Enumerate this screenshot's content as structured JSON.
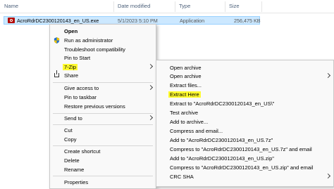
{
  "columns": {
    "name": "Name",
    "date_modified": "Date modified",
    "type": "Type",
    "size": "Size"
  },
  "file": {
    "name": "AcroRdrDC2300120143_en_US.exe",
    "date": "5/1/2023 5:10 PM",
    "type": "Application",
    "size": "256,475 KB",
    "icon": "pdf-icon"
  },
  "context_menu": {
    "open": "Open",
    "run_as_admin": "Run as administrator",
    "troubleshoot": "Troubleshoot compatibility",
    "pin_start": "Pin to Start",
    "seven_zip": "7-Zip",
    "share": "Share",
    "give_access": "Give access to",
    "pin_taskbar": "Pin to taskbar",
    "restore_versions": "Restore previous versions",
    "send_to": "Send to",
    "cut": "Cut",
    "copy": "Copy",
    "create_shortcut": "Create shortcut",
    "delete": "Delete",
    "rename": "Rename",
    "properties": "Properties"
  },
  "zip_menu": {
    "open_archive": "Open archive",
    "open_archive_sub": "Open archive",
    "extract_files": "Extract files...",
    "extract_here": "Extract Here",
    "extract_to": "Extract to \"AcroRdrDC2300120143_en_US\\\"",
    "test_archive": "Test archive",
    "add_to_archive": "Add to archive...",
    "compress_email": "Compress and email...",
    "add_to_7z": "Add to \"AcroRdrDC2300120143_en_US.7z\"",
    "compress_7z_email": "Compress to \"AcroRdrDC2300120143_en_US.7z\" and email",
    "add_to_zip": "Add to \"AcroRdrDC2300120143_en_US.zip\"",
    "compress_zip_email": "Compress to \"AcroRdrDC2300120143_en_US.zip\" and email",
    "crc_sha": "CRC SHA"
  },
  "highlight_color": "#fffb2e",
  "selection_color": "#cce8ff"
}
